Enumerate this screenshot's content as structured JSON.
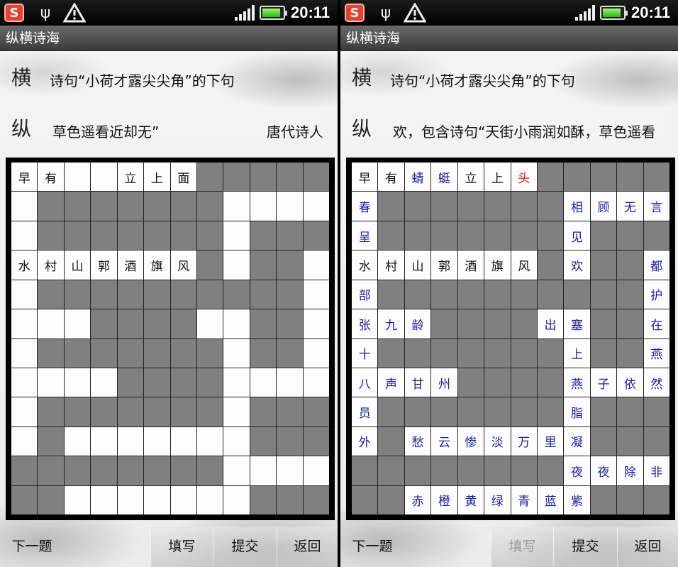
{
  "left": {
    "status": {
      "time": "20:11"
    },
    "title": "纵横诗海",
    "clue_h": {
      "tag": "横",
      "text": "诗句“小荷才露尖尖角”的下句"
    },
    "clue_v": {
      "tag": "纵",
      "text": "草色遥看近却无”",
      "text2": "唐代诗人"
    },
    "rows": [
      [
        {
          "t": "早",
          "c": "w"
        },
        {
          "t": "有",
          "c": "w"
        },
        {
          "t": "",
          "c": "w"
        },
        {
          "t": "",
          "c": "w"
        },
        {
          "t": "立",
          "c": "w"
        },
        {
          "t": "上",
          "c": "w"
        },
        {
          "t": "面",
          "c": "w"
        },
        {
          "t": "",
          "c": "g"
        },
        {
          "t": "",
          "c": "g"
        },
        {
          "t": "",
          "c": "g"
        },
        {
          "t": "",
          "c": "g"
        },
        {
          "t": "",
          "c": "g"
        }
      ],
      [
        {
          "t": "",
          "c": "w"
        },
        {
          "t": "",
          "c": "g"
        },
        {
          "t": "",
          "c": "g"
        },
        {
          "t": "",
          "c": "g"
        },
        {
          "t": "",
          "c": "g"
        },
        {
          "t": "",
          "c": "g"
        },
        {
          "t": "",
          "c": "g"
        },
        {
          "t": "",
          "c": "g"
        },
        {
          "t": "",
          "c": "w"
        },
        {
          "t": "",
          "c": "w"
        },
        {
          "t": "",
          "c": "w"
        },
        {
          "t": "",
          "c": "w"
        }
      ],
      [
        {
          "t": "",
          "c": "w"
        },
        {
          "t": "",
          "c": "g"
        },
        {
          "t": "",
          "c": "g"
        },
        {
          "t": "",
          "c": "g"
        },
        {
          "t": "",
          "c": "g"
        },
        {
          "t": "",
          "c": "g"
        },
        {
          "t": "",
          "c": "g"
        },
        {
          "t": "",
          "c": "g"
        },
        {
          "t": "",
          "c": "w"
        },
        {
          "t": "",
          "c": "g"
        },
        {
          "t": "",
          "c": "g"
        },
        {
          "t": "",
          "c": "g"
        }
      ],
      [
        {
          "t": "水",
          "c": "w"
        },
        {
          "t": "村",
          "c": "w"
        },
        {
          "t": "山",
          "c": "w"
        },
        {
          "t": "郭",
          "c": "w"
        },
        {
          "t": "酒",
          "c": "w"
        },
        {
          "t": "旗",
          "c": "w"
        },
        {
          "t": "风",
          "c": "w"
        },
        {
          "t": "",
          "c": "g"
        },
        {
          "t": "",
          "c": "w"
        },
        {
          "t": "",
          "c": "g"
        },
        {
          "t": "",
          "c": "g"
        },
        {
          "t": "",
          "c": "w"
        }
      ],
      [
        {
          "t": "",
          "c": "w"
        },
        {
          "t": "",
          "c": "g"
        },
        {
          "t": "",
          "c": "g"
        },
        {
          "t": "",
          "c": "g"
        },
        {
          "t": "",
          "c": "g"
        },
        {
          "t": "",
          "c": "g"
        },
        {
          "t": "",
          "c": "g"
        },
        {
          "t": "",
          "c": "g"
        },
        {
          "t": "",
          "c": "g"
        },
        {
          "t": "",
          "c": "g"
        },
        {
          "t": "",
          "c": "g"
        },
        {
          "t": "",
          "c": "w"
        }
      ],
      [
        {
          "t": "",
          "c": "w"
        },
        {
          "t": "",
          "c": "w"
        },
        {
          "t": "",
          "c": "w"
        },
        {
          "t": "",
          "c": "g"
        },
        {
          "t": "",
          "c": "g"
        },
        {
          "t": "",
          "c": "g"
        },
        {
          "t": "",
          "c": "g"
        },
        {
          "t": "",
          "c": "w"
        },
        {
          "t": "",
          "c": "w"
        },
        {
          "t": "",
          "c": "g"
        },
        {
          "t": "",
          "c": "g"
        },
        {
          "t": "",
          "c": "w"
        }
      ],
      [
        {
          "t": "",
          "c": "w"
        },
        {
          "t": "",
          "c": "g"
        },
        {
          "t": "",
          "c": "g"
        },
        {
          "t": "",
          "c": "g"
        },
        {
          "t": "",
          "c": "g"
        },
        {
          "t": "",
          "c": "g"
        },
        {
          "t": "",
          "c": "g"
        },
        {
          "t": "",
          "c": "g"
        },
        {
          "t": "",
          "c": "w"
        },
        {
          "t": "",
          "c": "g"
        },
        {
          "t": "",
          "c": "g"
        },
        {
          "t": "",
          "c": "w"
        }
      ],
      [
        {
          "t": "",
          "c": "w"
        },
        {
          "t": "",
          "c": "w"
        },
        {
          "t": "",
          "c": "w"
        },
        {
          "t": "",
          "c": "w"
        },
        {
          "t": "",
          "c": "g"
        },
        {
          "t": "",
          "c": "g"
        },
        {
          "t": "",
          "c": "g"
        },
        {
          "t": "",
          "c": "g"
        },
        {
          "t": "",
          "c": "w"
        },
        {
          "t": "",
          "c": "w"
        },
        {
          "t": "",
          "c": "w"
        },
        {
          "t": "",
          "c": "w"
        }
      ],
      [
        {
          "t": "",
          "c": "w"
        },
        {
          "t": "",
          "c": "g"
        },
        {
          "t": "",
          "c": "g"
        },
        {
          "t": "",
          "c": "g"
        },
        {
          "t": "",
          "c": "g"
        },
        {
          "t": "",
          "c": "g"
        },
        {
          "t": "",
          "c": "g"
        },
        {
          "t": "",
          "c": "g"
        },
        {
          "t": "",
          "c": "w"
        },
        {
          "t": "",
          "c": "g"
        },
        {
          "t": "",
          "c": "g"
        },
        {
          "t": "",
          "c": "g"
        }
      ],
      [
        {
          "t": "",
          "c": "w"
        },
        {
          "t": "",
          "c": "g"
        },
        {
          "t": "",
          "c": "w"
        },
        {
          "t": "",
          "c": "w"
        },
        {
          "t": "",
          "c": "w"
        },
        {
          "t": "",
          "c": "w"
        },
        {
          "t": "",
          "c": "w"
        },
        {
          "t": "",
          "c": "w"
        },
        {
          "t": "",
          "c": "w"
        },
        {
          "t": "",
          "c": "g"
        },
        {
          "t": "",
          "c": "g"
        },
        {
          "t": "",
          "c": "g"
        }
      ],
      [
        {
          "t": "",
          "c": "g"
        },
        {
          "t": "",
          "c": "g"
        },
        {
          "t": "",
          "c": "g"
        },
        {
          "t": "",
          "c": "g"
        },
        {
          "t": "",
          "c": "g"
        },
        {
          "t": "",
          "c": "g"
        },
        {
          "t": "",
          "c": "g"
        },
        {
          "t": "",
          "c": "g"
        },
        {
          "t": "",
          "c": "w"
        },
        {
          "t": "",
          "c": "w"
        },
        {
          "t": "",
          "c": "w"
        },
        {
          "t": "",
          "c": "w"
        }
      ],
      [
        {
          "t": "",
          "c": "g"
        },
        {
          "t": "",
          "c": "g"
        },
        {
          "t": "",
          "c": "w"
        },
        {
          "t": "",
          "c": "w"
        },
        {
          "t": "",
          "c": "w"
        },
        {
          "t": "",
          "c": "w"
        },
        {
          "t": "",
          "c": "w"
        },
        {
          "t": "",
          "c": "w"
        },
        {
          "t": "",
          "c": "w"
        },
        {
          "t": "",
          "c": "g"
        },
        {
          "t": "",
          "c": "g"
        },
        {
          "t": "",
          "c": "g"
        }
      ]
    ],
    "buttons": {
      "next": "下一题",
      "fill": "填写",
      "submit": "提交",
      "back": "返回"
    },
    "fill_disabled": false
  },
  "right": {
    "status": {
      "time": "20:11"
    },
    "title": "纵横诗海",
    "clue_h": {
      "tag": "横",
      "text": "诗句“小荷才露尖尖角”的下句"
    },
    "clue_v": {
      "tag": "纵",
      "text": "欢，包含诗句“天街小雨润如酥，草色遥看",
      "text2": ""
    },
    "rows": [
      [
        {
          "t": "早",
          "c": "w"
        },
        {
          "t": "有",
          "c": "w"
        },
        {
          "t": "蜻",
          "c": "wb"
        },
        {
          "t": "蜓",
          "c": "wb"
        },
        {
          "t": "立",
          "c": "w"
        },
        {
          "t": "上",
          "c": "w"
        },
        {
          "t": "头",
          "c": "wr"
        },
        {
          "t": "",
          "c": "g"
        },
        {
          "t": "",
          "c": "g"
        },
        {
          "t": "",
          "c": "g"
        },
        {
          "t": "",
          "c": "g"
        },
        {
          "t": "",
          "c": "g"
        }
      ],
      [
        {
          "t": "春",
          "c": "wb"
        },
        {
          "t": "",
          "c": "g"
        },
        {
          "t": "",
          "c": "g"
        },
        {
          "t": "",
          "c": "g"
        },
        {
          "t": "",
          "c": "g"
        },
        {
          "t": "",
          "c": "g"
        },
        {
          "t": "",
          "c": "g"
        },
        {
          "t": "",
          "c": "g"
        },
        {
          "t": "相",
          "c": "wb"
        },
        {
          "t": "顾",
          "c": "wb"
        },
        {
          "t": "无",
          "c": "wb"
        },
        {
          "t": "言",
          "c": "wb"
        }
      ],
      [
        {
          "t": "呈",
          "c": "wb"
        },
        {
          "t": "",
          "c": "g"
        },
        {
          "t": "",
          "c": "g"
        },
        {
          "t": "",
          "c": "g"
        },
        {
          "t": "",
          "c": "g"
        },
        {
          "t": "",
          "c": "g"
        },
        {
          "t": "",
          "c": "g"
        },
        {
          "t": "",
          "c": "g"
        },
        {
          "t": "见",
          "c": "wb"
        },
        {
          "t": "",
          "c": "g"
        },
        {
          "t": "",
          "c": "g"
        },
        {
          "t": "",
          "c": "g"
        }
      ],
      [
        {
          "t": "水",
          "c": "w"
        },
        {
          "t": "村",
          "c": "w"
        },
        {
          "t": "山",
          "c": "w"
        },
        {
          "t": "郭",
          "c": "w"
        },
        {
          "t": "酒",
          "c": "w"
        },
        {
          "t": "旗",
          "c": "w"
        },
        {
          "t": "风",
          "c": "w"
        },
        {
          "t": "",
          "c": "g"
        },
        {
          "t": "欢",
          "c": "wb"
        },
        {
          "t": "",
          "c": "g"
        },
        {
          "t": "",
          "c": "g"
        },
        {
          "t": "都",
          "c": "wb"
        }
      ],
      [
        {
          "t": "部",
          "c": "wb"
        },
        {
          "t": "",
          "c": "g"
        },
        {
          "t": "",
          "c": "g"
        },
        {
          "t": "",
          "c": "g"
        },
        {
          "t": "",
          "c": "g"
        },
        {
          "t": "",
          "c": "g"
        },
        {
          "t": "",
          "c": "g"
        },
        {
          "t": "",
          "c": "g"
        },
        {
          "t": "",
          "c": "g"
        },
        {
          "t": "",
          "c": "g"
        },
        {
          "t": "",
          "c": "g"
        },
        {
          "t": "护",
          "c": "wb"
        }
      ],
      [
        {
          "t": "张",
          "c": "wb"
        },
        {
          "t": "九",
          "c": "wb"
        },
        {
          "t": "龄",
          "c": "wb"
        },
        {
          "t": "",
          "c": "g"
        },
        {
          "t": "",
          "c": "g"
        },
        {
          "t": "",
          "c": "g"
        },
        {
          "t": "",
          "c": "g"
        },
        {
          "t": "出",
          "c": "wb"
        },
        {
          "t": "塞",
          "c": "wb"
        },
        {
          "t": "",
          "c": "g"
        },
        {
          "t": "",
          "c": "g"
        },
        {
          "t": "在",
          "c": "wb"
        }
      ],
      [
        {
          "t": "十",
          "c": "wb"
        },
        {
          "t": "",
          "c": "g"
        },
        {
          "t": "",
          "c": "g"
        },
        {
          "t": "",
          "c": "g"
        },
        {
          "t": "",
          "c": "g"
        },
        {
          "t": "",
          "c": "g"
        },
        {
          "t": "",
          "c": "g"
        },
        {
          "t": "",
          "c": "g"
        },
        {
          "t": "上",
          "c": "wb"
        },
        {
          "t": "",
          "c": "g"
        },
        {
          "t": "",
          "c": "g"
        },
        {
          "t": "燕",
          "c": "wb"
        }
      ],
      [
        {
          "t": "八",
          "c": "wb"
        },
        {
          "t": "声",
          "c": "wb"
        },
        {
          "t": "甘",
          "c": "wb"
        },
        {
          "t": "州",
          "c": "wb"
        },
        {
          "t": "",
          "c": "g"
        },
        {
          "t": "",
          "c": "g"
        },
        {
          "t": "",
          "c": "g"
        },
        {
          "t": "",
          "c": "g"
        },
        {
          "t": "燕",
          "c": "wb"
        },
        {
          "t": "子",
          "c": "wb"
        },
        {
          "t": "依",
          "c": "wb"
        },
        {
          "t": "然",
          "c": "wb"
        }
      ],
      [
        {
          "t": "员",
          "c": "wb"
        },
        {
          "t": "",
          "c": "g"
        },
        {
          "t": "",
          "c": "g"
        },
        {
          "t": "",
          "c": "g"
        },
        {
          "t": "",
          "c": "g"
        },
        {
          "t": "",
          "c": "g"
        },
        {
          "t": "",
          "c": "g"
        },
        {
          "t": "",
          "c": "g"
        },
        {
          "t": "脂",
          "c": "wb"
        },
        {
          "t": "",
          "c": "g"
        },
        {
          "t": "",
          "c": "g"
        },
        {
          "t": "",
          "c": "g"
        }
      ],
      [
        {
          "t": "外",
          "c": "wb"
        },
        {
          "t": "",
          "c": "g"
        },
        {
          "t": "愁",
          "c": "wb"
        },
        {
          "t": "云",
          "c": "wb"
        },
        {
          "t": "惨",
          "c": "wb"
        },
        {
          "t": "淡",
          "c": "wb"
        },
        {
          "t": "万",
          "c": "wb"
        },
        {
          "t": "里",
          "c": "wb"
        },
        {
          "t": "凝",
          "c": "wb"
        },
        {
          "t": "",
          "c": "g"
        },
        {
          "t": "",
          "c": "g"
        },
        {
          "t": "",
          "c": "g"
        }
      ],
      [
        {
          "t": "",
          "c": "g"
        },
        {
          "t": "",
          "c": "g"
        },
        {
          "t": "",
          "c": "g"
        },
        {
          "t": "",
          "c": "g"
        },
        {
          "t": "",
          "c": "g"
        },
        {
          "t": "",
          "c": "g"
        },
        {
          "t": "",
          "c": "g"
        },
        {
          "t": "",
          "c": "g"
        },
        {
          "t": "夜",
          "c": "wb"
        },
        {
          "t": "夜",
          "c": "wb"
        },
        {
          "t": "除",
          "c": "wb"
        },
        {
          "t": "非",
          "c": "wb"
        }
      ],
      [
        {
          "t": "",
          "c": "g"
        },
        {
          "t": "",
          "c": "g"
        },
        {
          "t": "赤",
          "c": "wb"
        },
        {
          "t": "橙",
          "c": "wb"
        },
        {
          "t": "黄",
          "c": "wb"
        },
        {
          "t": "绿",
          "c": "wb"
        },
        {
          "t": "青",
          "c": "wb"
        },
        {
          "t": "蓝",
          "c": "wb"
        },
        {
          "t": "紫",
          "c": "wb"
        },
        {
          "t": "",
          "c": "g"
        },
        {
          "t": "",
          "c": "g"
        },
        {
          "t": "",
          "c": "g"
        }
      ]
    ],
    "buttons": {
      "next": "下一题",
      "fill": "填写",
      "submit": "提交",
      "back": "返回"
    },
    "fill_disabled": true
  },
  "colors": {
    "user_answer": "#1520a6",
    "highlight": "#e01010",
    "block": "#808080"
  }
}
